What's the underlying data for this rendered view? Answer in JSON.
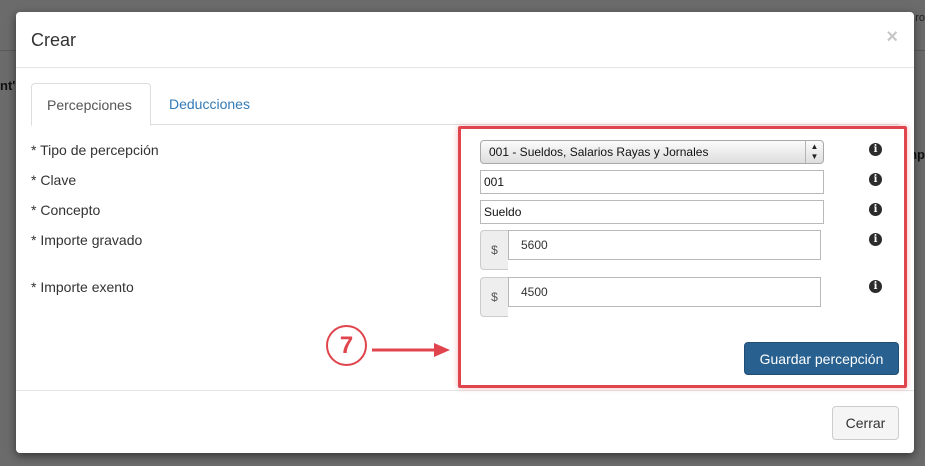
{
  "background": {
    "left_fragment": "nt' ]",
    "right_fragment": "mp",
    "topright_fragment": "ro"
  },
  "modal": {
    "title": "Crear",
    "close_symbol": "×"
  },
  "tabs": [
    {
      "label": "Percepciones",
      "active": true
    },
    {
      "label": "Deducciones",
      "active": false
    }
  ],
  "form": {
    "tipo": {
      "label": "* Tipo de percepción",
      "value": "001 - Sueldos, Salarios Rayas y Jornales"
    },
    "clave": {
      "label": "* Clave",
      "value": "001"
    },
    "concepto": {
      "label": "* Concepto",
      "value": "Sueldo"
    },
    "gravado": {
      "label": "* Importe gravado",
      "addon": "$",
      "value": "5600"
    },
    "exento": {
      "label": "* Importe exento",
      "addon": "$",
      "value": "4500"
    },
    "info_glyph": "i",
    "save_label": "Guardar percepción"
  },
  "footer": {
    "close_label": "Cerrar"
  },
  "annotation": {
    "step_number": "7",
    "color": "#e0454d"
  },
  "colors": {
    "primary": "#286090",
    "link": "#337ab7",
    "annotation": "#e0454d"
  }
}
